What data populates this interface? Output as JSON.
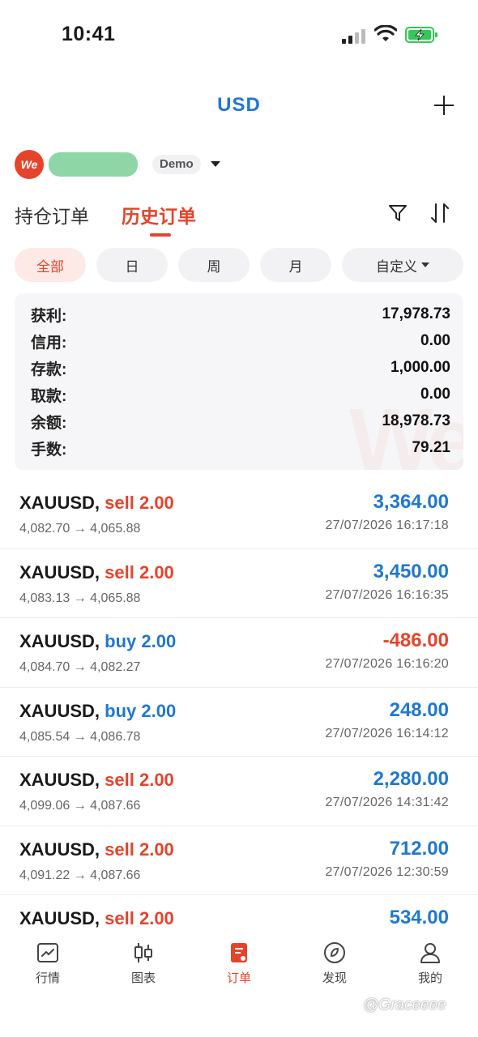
{
  "status_bar": {
    "time": "10:41"
  },
  "header": {
    "title": "USD"
  },
  "account": {
    "logo_text": "We",
    "badge": "Demo"
  },
  "tabs": {
    "open_orders": "持仓订单",
    "history_orders": "历史订单"
  },
  "periods": {
    "all": "全部",
    "day": "日",
    "week": "周",
    "month": "月",
    "custom": "自定义"
  },
  "summary": {
    "watermark": "We",
    "rows": [
      {
        "label": "获利:",
        "value": "17,978.73"
      },
      {
        "label": "信用:",
        "value": "0.00"
      },
      {
        "label": "存款:",
        "value": "1,000.00"
      },
      {
        "label": "取款:",
        "value": "0.00"
      },
      {
        "label": "余额:",
        "value": "18,978.73"
      },
      {
        "label": "手数:",
        "value": "79.21"
      }
    ]
  },
  "orders": [
    {
      "symbol": "XAUUSD,",
      "side": "sell",
      "volume": "2.00",
      "prices": "4,082.70 → 4,065.88",
      "profit": "3,364.00",
      "time": "27/07/2026 16:17:18"
    },
    {
      "symbol": "XAUUSD,",
      "side": "sell",
      "volume": "2.00",
      "prices": "4,083.13 → 4,065.88",
      "profit": "3,450.00",
      "time": "27/07/2026 16:16:35"
    },
    {
      "symbol": "XAUUSD,",
      "side": "buy",
      "volume": "2.00",
      "prices": "4,084.70 → 4,082.27",
      "profit": "-486.00",
      "time": "27/07/2026 16:16:20"
    },
    {
      "symbol": "XAUUSD,",
      "side": "buy",
      "volume": "2.00",
      "prices": "4,085.54 → 4,086.78",
      "profit": "248.00",
      "time": "27/07/2026 16:14:12"
    },
    {
      "symbol": "XAUUSD,",
      "side": "sell",
      "volume": "2.00",
      "prices": "4,099.06 → 4,087.66",
      "profit": "2,280.00",
      "time": "27/07/2026 14:31:42"
    },
    {
      "symbol": "XAUUSD,",
      "side": "sell",
      "volume": "2.00",
      "prices": "4,091.22 → 4,087.66",
      "profit": "712.00",
      "time": "27/07/2026 12:30:59"
    },
    {
      "symbol": "XAUUSD,",
      "side": "sell",
      "volume": "2.00",
      "prices": "",
      "profit": "534.00",
      "time": ""
    }
  ],
  "bottom_nav": [
    {
      "label": "行情",
      "icon": "market-icon"
    },
    {
      "label": "图表",
      "icon": "chart-icon"
    },
    {
      "label": "订单",
      "icon": "orders-icon",
      "active": true
    },
    {
      "label": "发现",
      "icon": "discover-icon"
    },
    {
      "label": "我的",
      "icon": "profile-icon"
    }
  ],
  "watermark": "@Graceeee",
  "colors": {
    "accent_red": "#e6432b",
    "accent_blue": "#1f78d1"
  }
}
